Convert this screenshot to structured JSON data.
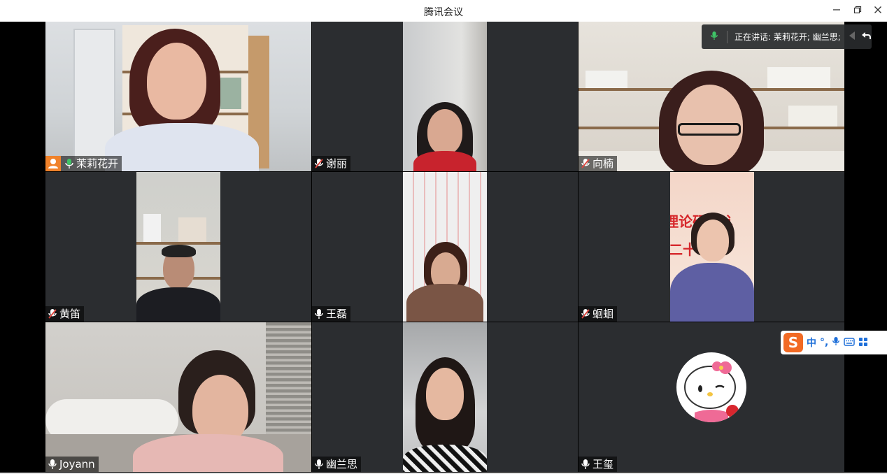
{
  "window": {
    "title": "腾讯会议"
  },
  "speaking": {
    "text": "正在讲话: 茉莉花开; 幽兰思;"
  },
  "participants": [
    {
      "name": "茉莉花开",
      "mic": "active"
    },
    {
      "name": "谢丽",
      "mic": "muted"
    },
    {
      "name": "向楠",
      "mic": "muted"
    },
    {
      "name": "黄笛",
      "mic": "muted"
    },
    {
      "name": "王磊",
      "mic": "on"
    },
    {
      "name": "蛔蛔",
      "mic": "muted"
    },
    {
      "name": "Joyann",
      "mic": "on"
    },
    {
      "name": "幽兰思",
      "mic": "on"
    },
    {
      "name": "王玺",
      "mic": "on"
    }
  ],
  "background_text": {
    "line1": "理论研 家讠",
    "line2": "二十 列"
  },
  "ime": {
    "mode": "中",
    "punct": "°,",
    "logo": "S"
  },
  "colors": {
    "active_green": "#3fc567",
    "muted_red": "#e0443c",
    "host_orange": "#f0822a",
    "tile_bg": "#2b2d30"
  }
}
